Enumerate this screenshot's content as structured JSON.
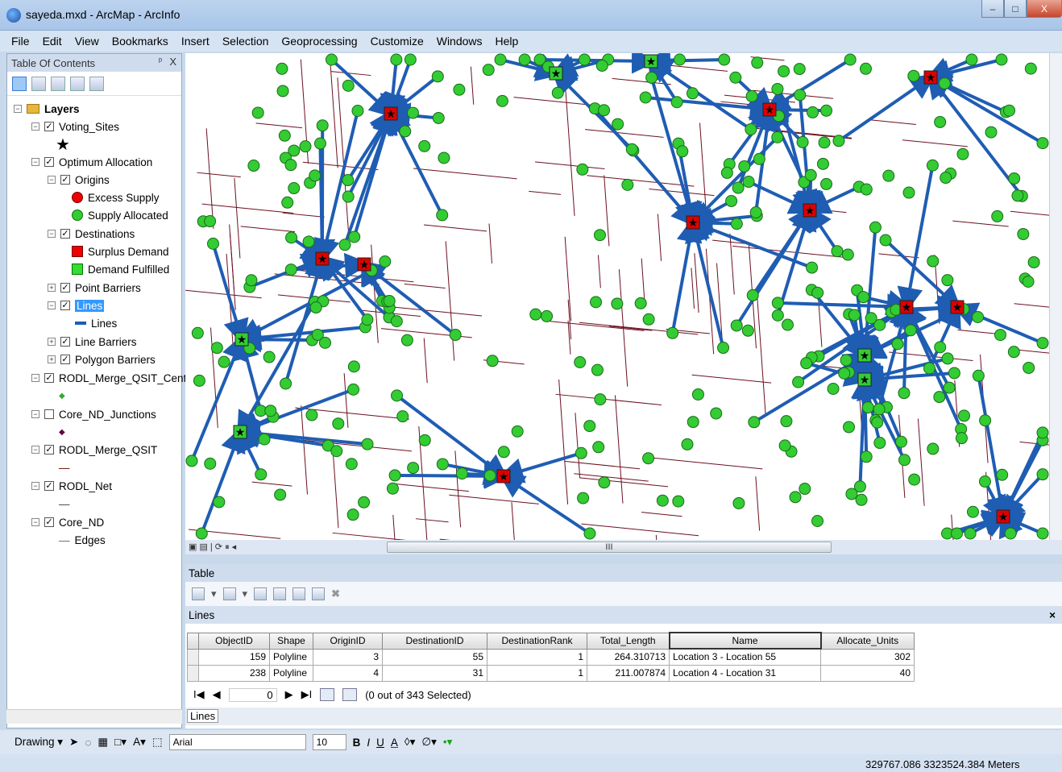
{
  "window": {
    "title": "sayeda.mxd - ArcMap - ArcInfo",
    "min": "–",
    "max": "□",
    "close": "X"
  },
  "menu": [
    "File",
    "Edit",
    "View",
    "Bookmarks",
    "Insert",
    "Selection",
    "Geoprocessing",
    "Customize",
    "Windows",
    "Help"
  ],
  "toc": {
    "title": "Table Of Contents",
    "pin": "ᵖ",
    "close": "X",
    "items": {
      "layers": "Layers",
      "voting_sites": "Voting_Sites",
      "optimum_allocation": "Optimum Allocation",
      "origins": "Origins",
      "excess_supply": "Excess Supply",
      "supply_allocated": "Supply Allocated",
      "destinations": "Destinations",
      "surplus_demand": "Surplus Demand",
      "demand_fulfilled": "Demand Fulfilled",
      "point_barriers": "Point Barriers",
      "lines": "Lines",
      "lines_symbol": "Lines",
      "line_barriers": "Line Barriers",
      "polygon_barriers": "Polygon Barriers",
      "rodl_center": "RODL_Merge_QSIT_Center",
      "core_nd_junctions": "Core_ND_Junctions",
      "rodl_merge": "RODL_Merge_QSIT",
      "rodl_net": "RODL_Net",
      "core_nd": "Core_ND",
      "edges": "Edges"
    }
  },
  "mapbar": {
    "scroll_marker": "III"
  },
  "table": {
    "window_title": "Table",
    "tab_title": "Lines",
    "close": "×",
    "columns": [
      "ObjectID",
      "Shape",
      "OriginID",
      "DestinationID",
      "DestinationRank",
      "Total_Length",
      "Name",
      "Allocate_Units"
    ],
    "rows": [
      [
        "159",
        "Polyline",
        "3",
        "55",
        "1",
        "264.310713",
        "Location 3 - Location 55",
        "302"
      ],
      [
        "238",
        "Polyline",
        "4",
        "31",
        "1",
        "211.007874",
        "Location 4 - Location 31",
        "40"
      ]
    ],
    "nav": {
      "first": "I◀",
      "prev": "◀",
      "page": "0",
      "next": "▶",
      "last": "▶I",
      "selected": "(0 out of 343 Selected)"
    },
    "bottom_tab": "Lines"
  },
  "drawing": {
    "label": "Drawing ▾",
    "font": "Arial",
    "size": "10",
    "bold": "B",
    "italic": "I",
    "underline": "U",
    "font_color": "A"
  },
  "status": {
    "coords": "329767.086  3323524.384 Meters"
  },
  "colors": {
    "flow": "#1f5db3",
    "origin": "#33cc33",
    "surplus": "#dd0000",
    "roads": "#6b1020"
  }
}
